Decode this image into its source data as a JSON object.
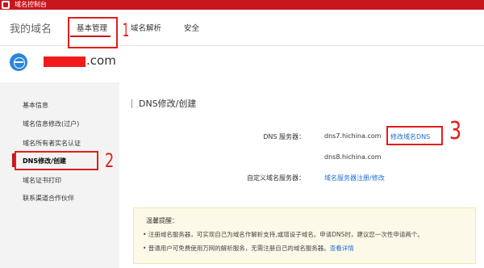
{
  "app": {
    "title": "域名控制台"
  },
  "header": {
    "page_title": "我的域名",
    "tabs": [
      {
        "label": "基本管理",
        "active": true
      },
      {
        "label": "域名解析",
        "active": false
      },
      {
        "label": "安全",
        "active": false
      }
    ]
  },
  "domain": {
    "suffix": ".com",
    "icon": "globe-icon"
  },
  "sidebar": {
    "items": [
      {
        "label": "基本信息"
      },
      {
        "label": "域名信息修改(过户)"
      },
      {
        "label": "域名所有者实名认证"
      },
      {
        "label": "DNS修改/创建",
        "active": true
      },
      {
        "label": "域名证书打印"
      },
      {
        "label": "联系渠道合作伙伴"
      }
    ]
  },
  "main": {
    "section_title": "DNS修改/创建",
    "dns_label": "DNS 服务器：",
    "dns_servers": [
      "dns7.hichina.com",
      "dns8.hichina.com"
    ],
    "modify_dns_link": "修改域名DNS",
    "custom_dns_label": "自定义域名服务器：",
    "custom_dns_link": "域名服务器注册/修改"
  },
  "tip": {
    "title": "温馨提醒：",
    "line1": "• 注册域名服务器，可实现自己为域名作解析支持,或增设子域名。申请DNS时，建议您一次性申请两个。",
    "line2_prefix": "• 普通用户可免费使用万网的解析服务，无需注册自己的域名服务器。",
    "line2_link": "查看详情"
  },
  "annotations": {
    "n1": "1",
    "n2": "2",
    "n3": "3"
  },
  "colors": {
    "brand": "#c8161d",
    "annotation": "#e31d1d",
    "link": "#1e6fd0"
  }
}
